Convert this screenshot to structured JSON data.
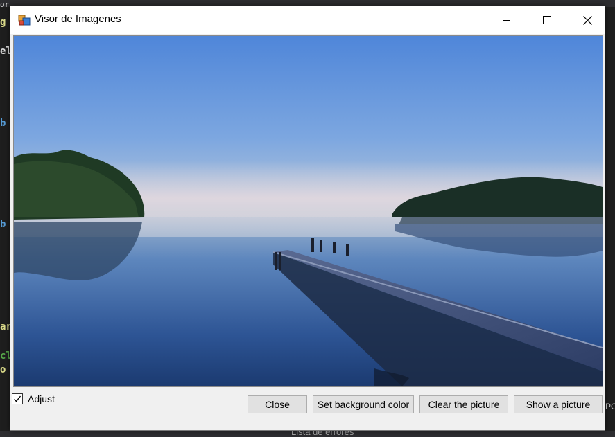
{
  "window": {
    "title": "Visor de Imagenes"
  },
  "controls": {
    "adjust_label": "Adjust",
    "adjust_checked": true,
    "buttons": {
      "close": "Close",
      "set_background": "Set background color",
      "clear": "Clear the picture",
      "show": "Show a picture"
    }
  },
  "icons": {
    "app": "picture-viewer-icon",
    "minimize": "minimize-icon",
    "maximize": "maximize-icon",
    "close": "close-icon",
    "check": "check-icon"
  },
  "background": {
    "left_fragments": [
      "or",
      "g",
      "el",
      "b",
      "b",
      "ar",
      "cl",
      "o"
    ],
    "bottom_text": "Lista de errores",
    "right_text": "PC"
  }
}
